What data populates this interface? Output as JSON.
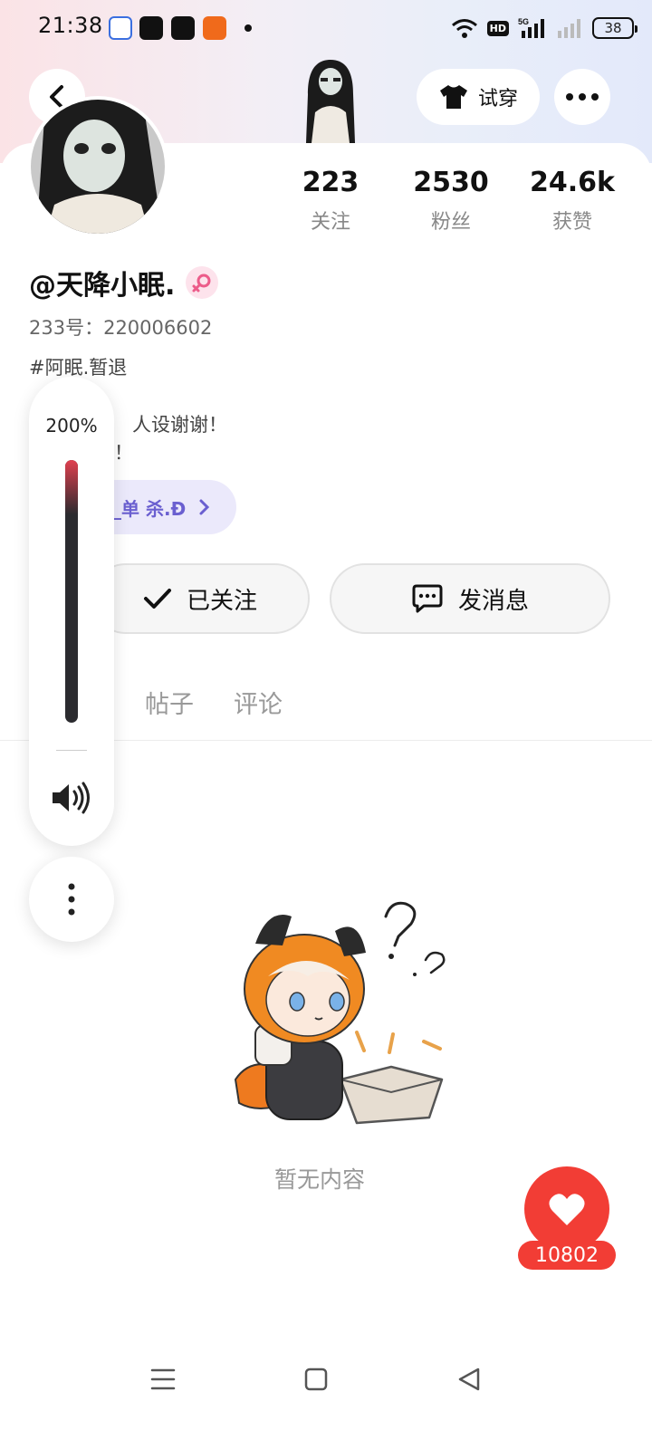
{
  "status_bar": {
    "time": "21:38",
    "hd_label": "HD",
    "network_label": "5G",
    "battery": "38"
  },
  "header": {
    "try_on_label": "试穿"
  },
  "profile": {
    "stats": [
      {
        "value": "223",
        "label": "关注"
      },
      {
        "value": "2530",
        "label": "粉丝"
      },
      {
        "value": "24.6k",
        "label": "获赞"
      }
    ],
    "username": "@天降小眠.",
    "uid": "233号：220006602",
    "bio_line1": "#阿眠.暂退",
    "bio_line2_fragment": "人设谢谢！",
    "bio_line3_fragment": "！",
    "linked_tag": "_单 杀.Đ"
  },
  "actions": {
    "follow_label": "已关注",
    "message_label": "发消息"
  },
  "tabs": [
    {
      "label": "帖子"
    },
    {
      "label": "评论"
    }
  ],
  "empty_state": {
    "text": "暂无内容"
  },
  "like": {
    "count": "10802"
  },
  "volume": {
    "percent_label": "200%",
    "level": 1.0
  },
  "colors": {
    "accent_red": "#f23d35",
    "tag_purple": "#6a5fd0"
  }
}
